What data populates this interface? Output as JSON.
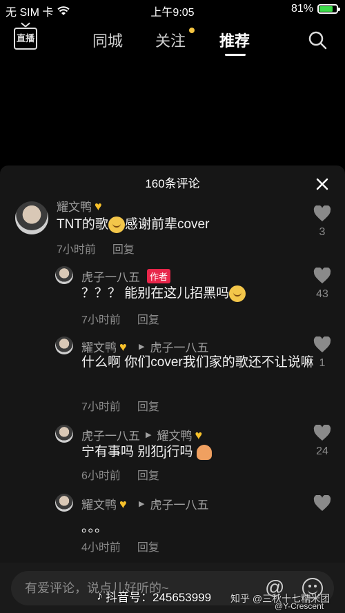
{
  "status_bar": {
    "carrier": "无 SIM 卡",
    "time": "上午9:05",
    "battery": "81%",
    "battery_level": 0.81
  },
  "nav": {
    "live_label": "直播",
    "tabs": [
      {
        "label": "同城"
      },
      {
        "label": "关注"
      },
      {
        "label": "推荐"
      }
    ]
  },
  "comments": {
    "title": "160条评论",
    "items": [
      {
        "user": "耀文鸭",
        "text": "TNT的歌",
        "text_after": "感谢前辈cover",
        "time": "7小时前",
        "reply": "回复",
        "likes": "3"
      },
      {
        "user": "虎子一八五",
        "badge": "作者",
        "text": "？？？ 能别在这儿招黑吗",
        "time": "7小时前",
        "reply": "回复",
        "likes": "43"
      },
      {
        "user": "耀文鸭",
        "reply_to": "虎子一八五",
        "text": "什么啊 你们cover我们家的歌还不让说嘛",
        "time": "7小时前",
        "reply": "回复",
        "likes": "1"
      },
      {
        "user": "虎子一八五",
        "reply_to": "耀文鸭",
        "text": "宁有事吗 别犯j行吗",
        "time": "6小时前",
        "reply": "回复",
        "likes": "24"
      },
      {
        "user": "耀文鸭",
        "reply_to": "虎子一八五",
        "text": "。。。",
        "time": "4小时前",
        "reply": "回复",
        "likes": ""
      }
    ]
  },
  "input": {
    "placeholder": "有爱评论，说点儿好听的~"
  },
  "watermark": {
    "douyin_id": "抖音号：245653999",
    "zhihu": "知乎 @三秋十七糯米团",
    "weibo": "@Y-Crescent"
  }
}
